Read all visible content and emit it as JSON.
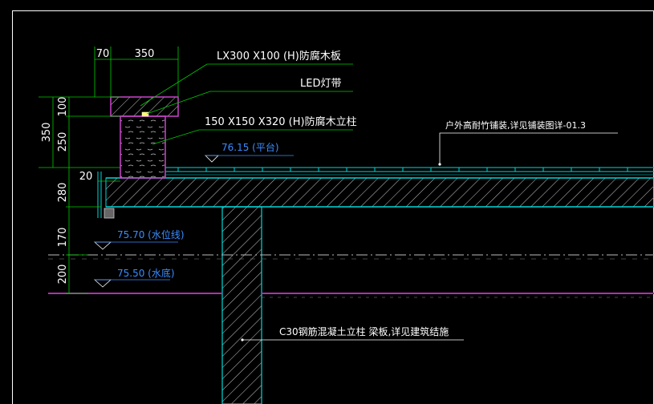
{
  "colors": {
    "background": "#000000",
    "frame": "#ffffff",
    "leader": "#00cc00",
    "concrete": "#00d8d8",
    "wood": "#cc44cc",
    "water": "#22aaff",
    "grade": "#aa33aa",
    "text": "#ffffff",
    "dim_text": "#ffffff",
    "elev_text": "#3a8cff"
  },
  "dimensions": {
    "top_width_a": "70",
    "top_width_b": "350",
    "left_total": "350",
    "cap_height": "100",
    "post_height": "250",
    "offset": "20",
    "slab": "280",
    "water_gap": "170",
    "water_depth": "200"
  },
  "callouts": {
    "cap": "LX300 X100 (H)防腐木板",
    "led": "LED灯带",
    "post": "150 X150 X320 (H)防腐木立柱",
    "paving": "户外高耐竹铺装,详见铺装图详-01.3",
    "column": "C30钢筋混凝土立柱 梁板,详见建筑结施"
  },
  "elevations": {
    "platform": "76.15 (平台)",
    "water_line": "75.70 (水位线)",
    "water_bottom": "75.50 (水底)"
  }
}
